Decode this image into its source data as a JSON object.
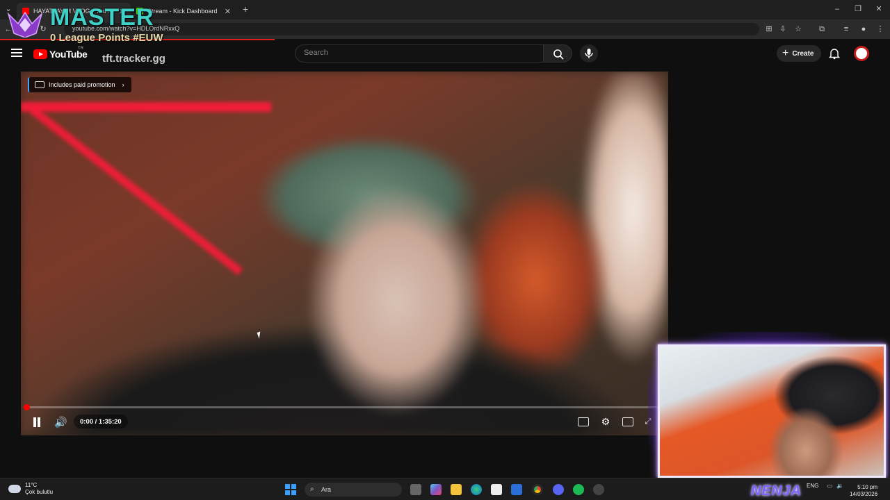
{
  "browser": {
    "tabs": [
      {
        "title": "HAYATTAYIM VLOG - YouT",
        "active": true
      },
      {
        "title": "Stream - Kick Dashboard",
        "active": false
      }
    ],
    "url": "youtube.com/watch?v=HDLOrdNRxxQ",
    "add_tab_icon": "plus-icon"
  },
  "overlay": {
    "rank": "MASTER",
    "league_points": "0 League Points #EUW",
    "tracker": "tft.tracker.gg",
    "streamer_name": "NENJA"
  },
  "youtube": {
    "logo_text": "YouTube",
    "region": "TR",
    "search_placeholder": "Search",
    "create_label": "Create"
  },
  "player": {
    "promo_label": "Includes paid promotion",
    "time": "0:00 / 1:35:20",
    "progress_fraction": 0.0
  },
  "taskbar": {
    "weather_temp": "11°C",
    "weather_desc": "Çok bulutlu",
    "search_label": "Ara",
    "language": "ENG",
    "time": "5:10 pm",
    "date": "14/03/2026"
  },
  "colors": {
    "youtube_red": "#ff0000",
    "overlay_teal": "#3fd0c7",
    "webcam_border": "#a878ff"
  }
}
